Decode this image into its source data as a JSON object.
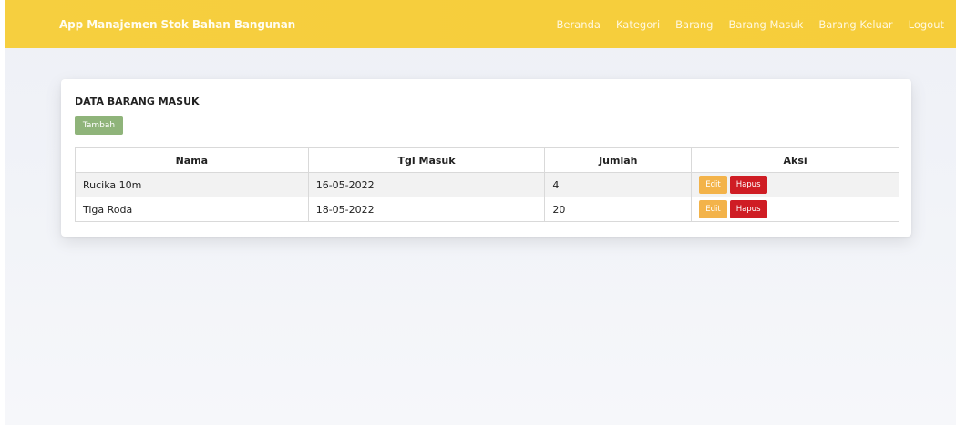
{
  "navbar": {
    "brand": "App Manajemen Stok Bahan Bangunan",
    "items": [
      "Beranda",
      "Kategori",
      "Barang",
      "Barang Masuk",
      "Barang Keluar",
      "Logout"
    ]
  },
  "card": {
    "title": "DATA BARANG MASUK",
    "add_label": "Tambah"
  },
  "table": {
    "headers": [
      "Nama",
      "Tgl Masuk",
      "Jumlah",
      "Aksi"
    ],
    "rows": [
      {
        "nama": "Rucika 10m",
        "tgl": "16-05-2022",
        "jumlah": "4"
      },
      {
        "nama": "Tiga Roda",
        "tgl": "18-05-2022",
        "jumlah": "20"
      }
    ],
    "edit_label": "Edit",
    "delete_label": "Hapus"
  },
  "colors": {
    "navbar": "#f6cf3f",
    "tambah": "#8fb47a",
    "edit": "#f3b34a",
    "hapus": "#cf1d24"
  }
}
